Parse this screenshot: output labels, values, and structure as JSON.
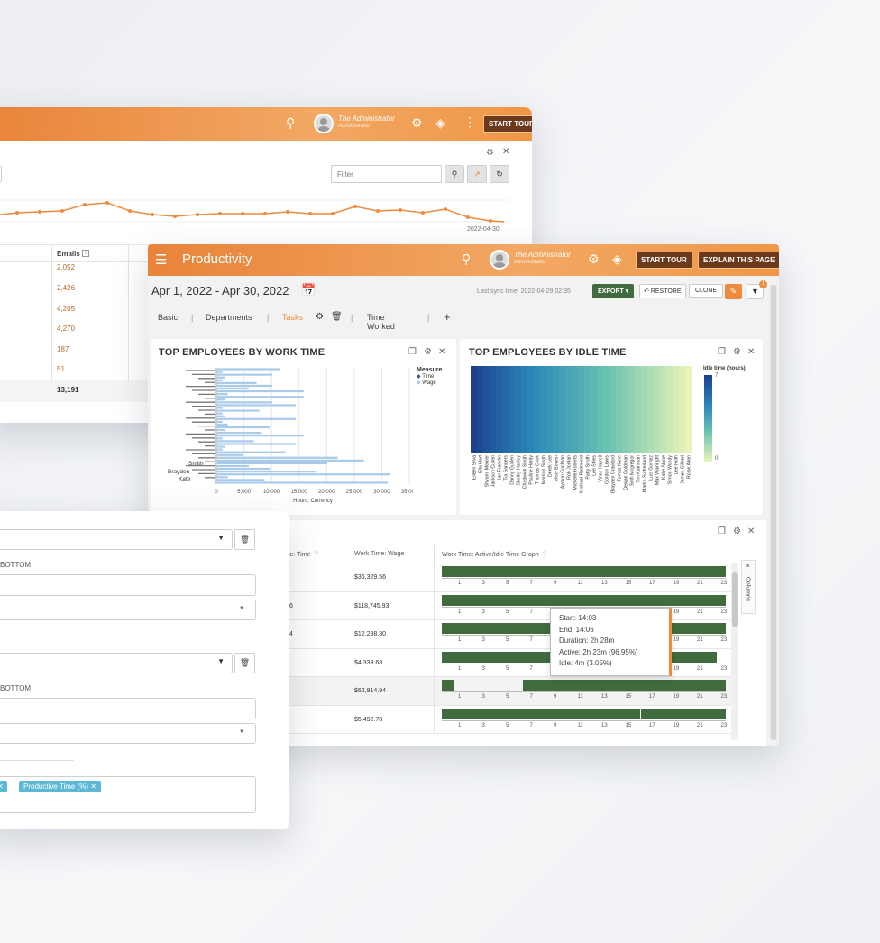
{
  "back_window": {
    "user": {
      "name": "The Administrator",
      "role": "Administrator"
    },
    "start_tour": "START TOUR",
    "filter_placeholder": "Filter",
    "end_date_label": "2022-04-30",
    "emails_header": "Emails",
    "emails": [
      "2,052",
      "2,426",
      "4,205",
      "4,270",
      "187",
      "51"
    ],
    "emails_total": "13,191"
  },
  "main_window": {
    "title": "Productivity",
    "user": {
      "name": "The Administrator",
      "role": "Administrator"
    },
    "start_tour": "START TOUR",
    "explain_page": "EXPLAIN THIS PAGE",
    "date_range": "Apr 1, 2022 - Apr 30, 2022",
    "sync_time": "Last sync time: 2022-04-29 02:35",
    "export": "EXPORT",
    "restore": "RESTORE",
    "clone": "CLONE",
    "filter_badge": "1",
    "tabs": [
      "Basic",
      "Departments",
      "Tasks",
      "Time Worked"
    ],
    "active_tab": "Tasks",
    "panel1": {
      "title": "TOP EMPLOYEES BY WORK TIME",
      "legend_title": "Measure",
      "legend": [
        "Time",
        "Wage"
      ],
      "xlabel": "Hours, Currency",
      "ticks": [
        "0",
        "5,000",
        "10,000",
        "15,000",
        "20,000",
        "25,000",
        "30,000",
        "35,000"
      ],
      "visible_labels": [
        "Smith",
        "Brayden",
        "Kate"
      ]
    },
    "panel2": {
      "title": "TOP EMPLOYEES BY IDLE TIME",
      "legend_title": "Idle time (hours)",
      "legend_max": "7",
      "legend_min": "0",
      "names": [
        "Eileen Silva",
        "Ella Hart",
        "Shyann Mercer",
        "Jackson Cullen",
        "Ian Franklin",
        "Tia Sanders",
        "Danny Guillen",
        "Shelby Hanley",
        "Chadwick Singh",
        "Pauline Hardy",
        "Thomas Cook",
        "Marrion Singh",
        "Derek Lee",
        "Misty Bowen",
        "Aymon Cochran",
        "Rob Jordan",
        "Michelle Roberts",
        "Michael Redmond",
        "Patty Smith",
        "Lee Stiles",
        "Vince Harrell",
        "Gordon Lewis",
        "Brayden Crawford",
        "Tomas Kane",
        "Dewan Goldman",
        "Seth Mcgregor",
        "Tim Kathman",
        "Martin Sutherland",
        "Luis Gomez",
        "Max Wainright",
        "Katie Stone",
        "Simon Woody",
        "Lee Roth",
        "James Gilbert",
        "Roise Allen"
      ]
    },
    "grid": {
      "headers": [
        "se: Time",
        "Work Time: Wage",
        "Work Time: Active/Idle Time Graph"
      ],
      "rows": [
        {
          "left": "",
          "wage": "$36,329.56"
        },
        {
          "left": "6",
          "wage": "$118,745.93"
        },
        {
          "left": "4",
          "wage": "$12,288.30"
        },
        {
          "left": "",
          "wage": "$4,333.68"
        },
        {
          "left": "",
          "wage": "$62,814.94"
        },
        {
          "left": "",
          "wage": "$5,492.78"
        }
      ],
      "hours": [
        "1",
        "3",
        "5",
        "7",
        "9",
        "11",
        "13",
        "15",
        "17",
        "19",
        "21",
        "23"
      ],
      "columns_label": "Columns",
      "tooltip": [
        "Start: 14:03",
        "End: 14:06",
        "Duration: 2h 28m",
        "Active: 2h 23m (96.95%)",
        "Idle: 4m (3.05%)"
      ]
    }
  },
  "config_window": {
    "bottom_label_1": "BOTTOM",
    "bottom_label_2": "BOTTOM",
    "tag": "Productive Time (%)"
  },
  "colors": {
    "accent": "#ee8b3d",
    "green": "#3f6b3f",
    "bar": "#a9cbeb"
  }
}
